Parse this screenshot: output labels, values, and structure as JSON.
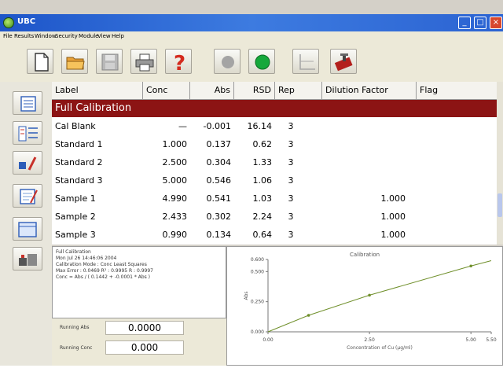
{
  "window": {
    "title": "UBC",
    "minimize": "_",
    "maximize": "□",
    "close": "×"
  },
  "menu": [
    "File",
    "Results",
    "Window",
    "Security",
    "Module",
    "View",
    "Help"
  ],
  "table": {
    "columns": [
      "Label",
      "Conc",
      "Abs",
      "RSD",
      "Rep",
      "Dilution Factor",
      "Flag"
    ],
    "group": "Full Calibration",
    "rows": [
      {
        "label": "Cal Blank",
        "conc": "—",
        "abs": "-0.001",
        "rsd": "16.14",
        "rep": "3",
        "dil": ""
      },
      {
        "label": "Standard 1",
        "conc": "1.000",
        "abs": "0.137",
        "rsd": "0.62",
        "rep": "3",
        "dil": ""
      },
      {
        "label": "Standard 2",
        "conc": "2.500",
        "abs": "0.304",
        "rsd": "1.33",
        "rep": "3",
        "dil": ""
      },
      {
        "label": "Standard 3",
        "conc": "5.000",
        "abs": "0.546",
        "rsd": "1.06",
        "rep": "3",
        "dil": ""
      },
      {
        "label": "Sample 1",
        "conc": "4.990",
        "abs": "0.541",
        "rsd": "1.03",
        "rep": "3",
        "dil": "1.000"
      },
      {
        "label": "Sample 2",
        "conc": "2.433",
        "abs": "0.302",
        "rsd": "2.24",
        "rep": "3",
        "dil": "1.000"
      },
      {
        "label": "Sample 3",
        "conc": "0.990",
        "abs": "0.134",
        "rsd": "0.64",
        "rep": "3",
        "dil": "1.000"
      }
    ]
  },
  "info": {
    "lines": [
      "Full Calibration",
      "Mon Jul 26 14:46:06 2004",
      "Calibration Mode : Conc Least Squares",
      "Max Error : 0.0469    R² : 0.9995    R : 0.9997",
      "Conc = Abs / ( 0.1442 + -0.0001 * Abs )"
    ]
  },
  "results": {
    "row1": {
      "label": "Running Abs",
      "value": "0.0000"
    },
    "row2": {
      "label": "Running Conc",
      "value": "0.000"
    }
  },
  "chart_data": {
    "type": "line",
    "title": "Calibration",
    "xlabel": "Concentration of Cu (µg/ml)",
    "ylabel": "Abs",
    "x_ticks": [
      "0.00",
      "2.50",
      "5.00",
      "5.50"
    ],
    "y_ticks": [
      "0.000",
      "0.250",
      "0.500",
      "0.600"
    ],
    "xlim": [
      0,
      5.5
    ],
    "ylim": [
      0,
      0.6
    ],
    "points": {
      "x": [
        1.0,
        2.5,
        5.0
      ],
      "y": [
        0.137,
        0.304,
        0.546
      ]
    },
    "curve": {
      "x": [
        0,
        1.0,
        2.5,
        5.0,
        5.5
      ],
      "y": [
        0.0,
        0.137,
        0.304,
        0.546,
        0.59
      ]
    },
    "colors": {
      "curve": "#6f8f2a",
      "points": "#6f8f2a"
    }
  },
  "colors": {
    "title_bar": "#2b63d2",
    "group_row": "#8c1414"
  }
}
